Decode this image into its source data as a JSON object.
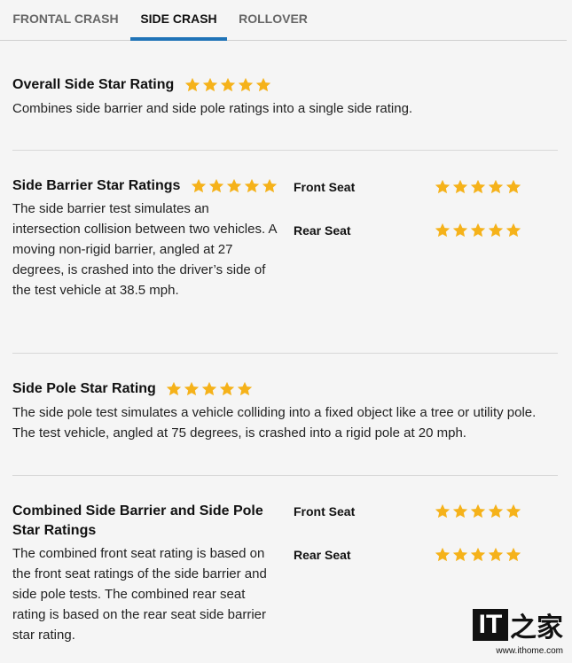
{
  "tabs": [
    {
      "label": "FRONTAL CRASH"
    },
    {
      "label": "SIDE CRASH"
    },
    {
      "label": "ROLLOVER"
    }
  ],
  "star_color": "#f5b21a",
  "overall": {
    "title": "Overall Side Star Rating",
    "rating": 5,
    "description": "Combines side barrier and side pole ratings into a single side rating."
  },
  "side_barrier": {
    "title": "Side Barrier Star Ratings",
    "rating": 5,
    "description": "The side barrier test simulates an intersection collision between two vehicles. A moving non-rigid barrier, angled at 27 degrees, is crashed into the driver’s side of the test vehicle at 38.5 mph.",
    "front_seat_label": "Front Seat",
    "front_seat_rating": 5,
    "rear_seat_label": "Rear Seat",
    "rear_seat_rating": 5
  },
  "side_pole": {
    "title": "Side Pole Star Rating",
    "rating": 5,
    "description": "The side pole test simulates a vehicle colliding into a fixed object like a tree or utility pole. The test vehicle, angled at 75 degrees, is crashed into a rigid pole at 20 mph."
  },
  "combined": {
    "title": "Combined Side Barrier and Side Pole Star Ratings",
    "description": "The combined front seat rating is based on the front seat ratings of the side barrier and side pole tests. The combined rear seat rating is based on the rear seat side barrier star rating.",
    "front_seat_label": "Front Seat",
    "front_seat_rating": 5,
    "rear_seat_label": "Rear Seat",
    "rear_seat_rating": 5
  },
  "watermark": {
    "logo_text": "IT",
    "logo_mark": "之家",
    "url": "www.ithome.com"
  }
}
